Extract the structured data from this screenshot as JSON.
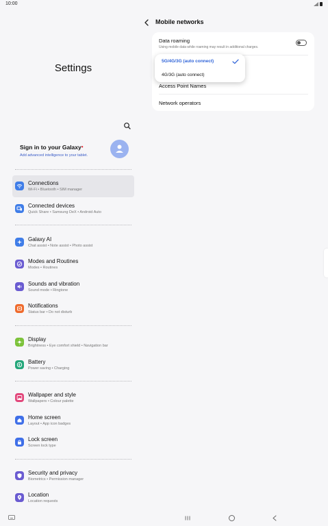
{
  "status": {
    "time": "10:00"
  },
  "settings": {
    "title": "Settings",
    "account": {
      "title": "Sign in to your Galaxy",
      "badge": "•",
      "subtitle": "Add advanced intelligence to your tablet."
    },
    "items": [
      {
        "label": "Connections",
        "sub": "Wi-Fi  •  Bluetooth  •  SIM manager",
        "icon": "wifi-icon",
        "color": "#3f7de8"
      },
      {
        "label": "Connected devices",
        "sub": "Quick Share  •  Samsung DeX  •  Android Auto",
        "icon": "devices-icon",
        "color": "#3f7de8"
      },
      {
        "label": "Galaxy AI",
        "sub": "Chat assist  •  Note assist  •  Photo assist",
        "icon": "sparkle-icon",
        "color": "#3f7de8"
      },
      {
        "label": "Modes and Routines",
        "sub": "Modes  •  Routines",
        "icon": "check-circle-icon",
        "color": "#6a5bd1"
      },
      {
        "label": "Sounds and vibration",
        "sub": "Sound mode  •  Ringtone",
        "icon": "speaker-icon",
        "color": "#6a5bd1"
      },
      {
        "label": "Notifications",
        "sub": "Status bar  •  Do not disturb",
        "icon": "bell-icon",
        "color": "#ef6b2d"
      },
      {
        "label": "Display",
        "sub": "Brightness  •  Eye comfort shield  •  Navigation bar",
        "icon": "sun-icon",
        "color": "#7cc23a"
      },
      {
        "label": "Battery",
        "sub": "Power saving  •  Charging",
        "icon": "battery-icon",
        "color": "#23a67a"
      },
      {
        "label": "Wallpaper and style",
        "sub": "Wallpapers  •  Colour palette",
        "icon": "image-icon",
        "color": "#e2477b"
      },
      {
        "label": "Home screen",
        "sub": "Layout  •  App icon badges",
        "icon": "home-icon",
        "color": "#3f6fe8"
      },
      {
        "label": "Lock screen",
        "sub": "Screen lock type",
        "icon": "lock-icon",
        "color": "#3f6fe8"
      },
      {
        "label": "Security and privacy",
        "sub": "Biometrics  •  Permission manager",
        "icon": "shield-icon",
        "color": "#6a5bd1"
      },
      {
        "label": "Location",
        "sub": "Location requests",
        "icon": "location-icon",
        "color": "#6a5bd1"
      }
    ]
  },
  "mobile_networks": {
    "title": "Mobile networks",
    "data_roaming": {
      "label": "Data roaming",
      "sub": "Using mobile data while roaming may result in additional charges.",
      "enabled": false
    },
    "network_mode_options": [
      {
        "label": "5G/4G/3G (auto connect)",
        "selected": true
      },
      {
        "label": "4G/3G (auto connect)",
        "selected": false
      }
    ],
    "access_point_names": "Access Point Names",
    "network_operators": "Network operators"
  }
}
